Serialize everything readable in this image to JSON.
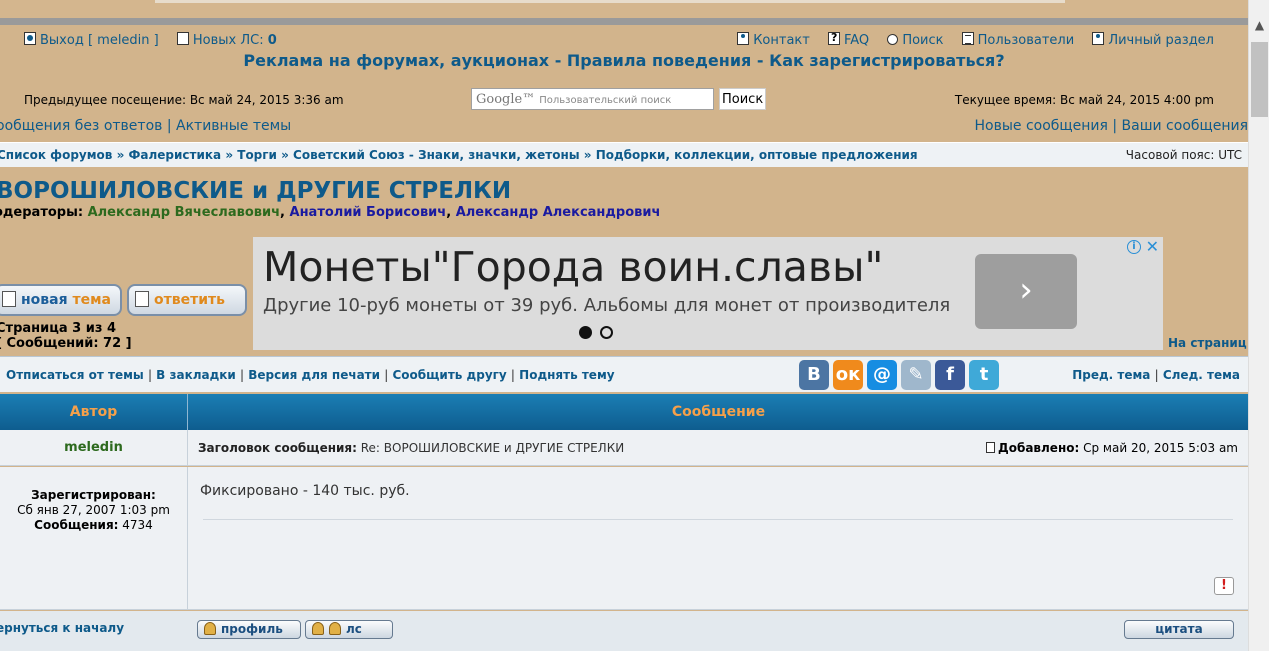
{
  "nav1": {
    "logout": "Выход [ meledin ]",
    "new_pm_label": "Новых ЛС:",
    "new_pm_count": "0",
    "contact": "Контакт",
    "faq": "FAQ",
    "search": "Поиск",
    "users": "Пользователи",
    "personal": "Личный раздел"
  },
  "nav2": {
    "ads": "Реклама на форумах, аукционах",
    "rules": "Правила поведения",
    "register": "Как зарегистрироваться?",
    "sep": "-"
  },
  "visits": {
    "previous": "Предыдущее посещение: Вс май 24, 2015 3:36 am",
    "current": "Текущее время: Вс май 24, 2015 4:00 pm",
    "search_placeholder": "Пользовательский поиск",
    "google_logo": "Google™",
    "search_button": "Поиск"
  },
  "nav3": {
    "unanswered": "ообщения без ответов",
    "active": "Активные темы",
    "new_posts": "Новые сообщения",
    "your_posts": "Ваши сообщения",
    "sep": "|"
  },
  "breadcrumbs": {
    "text": "Список форумов » Фалеристика » Торги » Советский Союз - Знаки, значки, жетоны » Подборки, коллекции, оптовые предложения",
    "timezone": "Часовой пояс: UTC"
  },
  "topic": {
    "title": "ВОРОШИЛОВСКИЕ и ДРУГИЕ СТРЕЛКИ",
    "moderators_label": "одераторы:",
    "moderator_1": "Александр Вячеславович",
    "moderator_2": "Анатолий Борисович",
    "moderator_3": "Александр Александрович",
    "comma": ","
  },
  "ad": {
    "headline": "Монеты\"Города воин.славы\"",
    "subtext": "Другие 10-руб монеты от 39 руб. Альбомы для монет от производителя",
    "arrow": "›",
    "info": "i",
    "close": "✕"
  },
  "buttons": {
    "new_topic_a": "новая ",
    "new_topic_b": "тема",
    "reply": "ответить"
  },
  "pageinfo": {
    "page": "Страница 3 из 4",
    "posts": "[ Сообщений: 72 ]",
    "on_page": "На страниц"
  },
  "actions": {
    "unsubscribe": "Отписаться от темы",
    "bookmark": "В закладки",
    "print": "Версия для печати",
    "tell_friend": "Сообщить другу",
    "bump": "Поднять тему",
    "prev_topic": "Пред. тема",
    "next_topic": "След. тема",
    "sep": "|"
  },
  "social": {
    "vk": "В",
    "ok": "ок",
    "mail": "@",
    "lj": "✎",
    "fb": "f",
    "tw": "t",
    "colors": {
      "vk": "#4c75a3",
      "ok": "#f08a1c",
      "mail": "#168de2",
      "lj": "#9fb7cc",
      "fb": "#3b5998",
      "tw": "#3fa9d8"
    }
  },
  "table": {
    "col_author": "Автор",
    "col_message": "Сообщение"
  },
  "post": {
    "author": "meledin",
    "subject_label": "Заголовок сообщения:",
    "subject": "Re: ВОРОШИЛОВСКИЕ и ДРУГИЕ СТРЕЛКИ",
    "posted_label": "Добавлено:",
    "posted": "Ср май 20, 2015 5:03 am",
    "registered_label": "Зарегистрирован:",
    "registered": "Сб янв 27, 2007 1:03 pm",
    "posts_label": "Сообщения:",
    "posts": "4734",
    "body": "Фиксировано - 140 тыс. руб.",
    "report": "!"
  },
  "footer": {
    "back_to_top": "ернуться к началу",
    "profile": "профиль",
    "pm": "лс",
    "quote": "цитата"
  },
  "scroll": {
    "up": "▲"
  }
}
